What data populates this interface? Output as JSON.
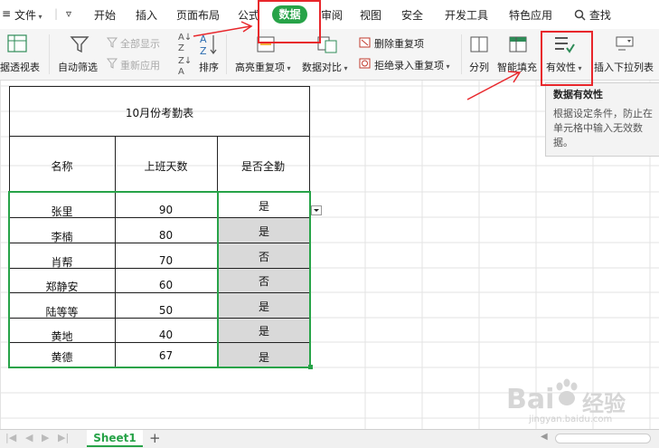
{
  "menu": {
    "file": "文件",
    "items": [
      "开始",
      "插入",
      "页面布局",
      "公式",
      "数据",
      "审阅",
      "视图",
      "安全",
      "开发工具",
      "特色应用"
    ],
    "search": "查找"
  },
  "ribbon": {
    "pivot": "据透视表",
    "autofilter": "自动筛选",
    "show_all": "全部显示",
    "reapply": "重新应用",
    "sort": "排序",
    "highlight_dup": "高亮重复项",
    "compare": "数据对比",
    "delete_dup": "删除重复项",
    "reject_dup": "拒绝录入重复项",
    "split": "分列",
    "smart_fill": "智能填充",
    "validity": "有效性",
    "dropdown_list": "插入下拉列表"
  },
  "tooltip": {
    "title": "数据有效性",
    "body": "根据设定条件，防止在单元格中输入无效数据。"
  },
  "sheet": {
    "title": "10月份考勤表",
    "headers": [
      "名称",
      "上班天数",
      "是否全勤"
    ],
    "rows": [
      [
        "张里",
        "90",
        "是"
      ],
      [
        "李楠",
        "80",
        "是"
      ],
      [
        "肖帮",
        "70",
        "否"
      ],
      [
        "郑静安",
        "60",
        "否"
      ],
      [
        "陆等等",
        "50",
        "是"
      ],
      [
        "黄地",
        "40",
        "是"
      ],
      [
        "黄德",
        "67",
        "是"
      ]
    ]
  },
  "tabs": {
    "sheet1": "Sheet1",
    "add": "+"
  },
  "watermark": {
    "brand": "Bai",
    "brand2": "经验",
    "url": "jingyan.baidu.com"
  },
  "colors": {
    "accent": "#27a348",
    "annotation": "#e8262b",
    "selected_fill": "#d9d9d9"
  }
}
